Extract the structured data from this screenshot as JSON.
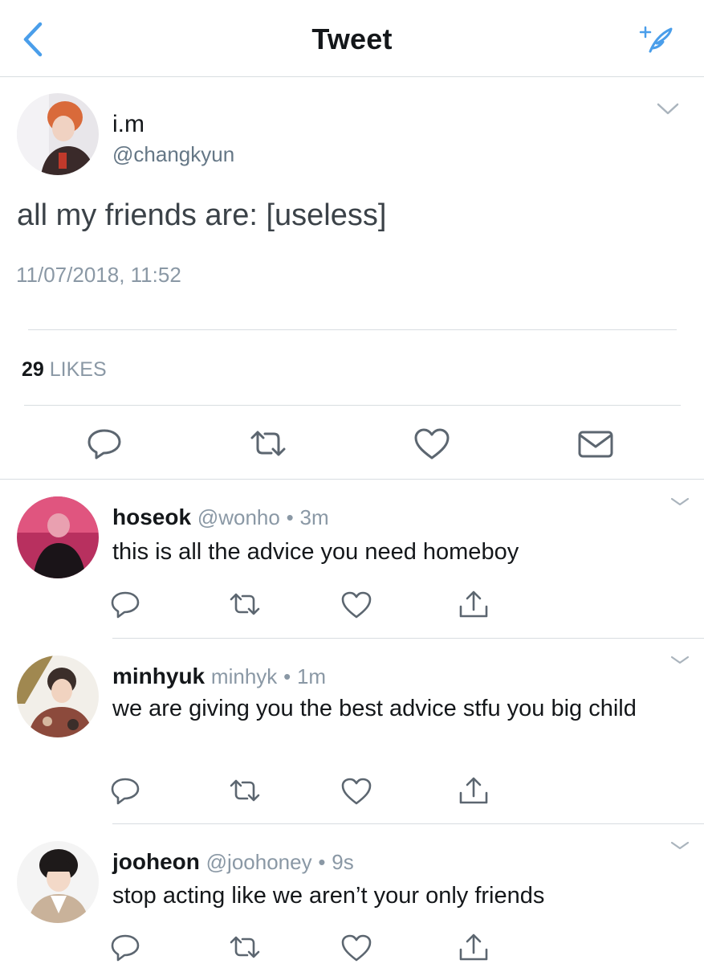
{
  "header": {
    "title": "Tweet",
    "back_icon": "chevron-left-icon",
    "compose_icon": "compose-sparkle-icon",
    "accent_color": "#4a9eea"
  },
  "tweet": {
    "name": "i.m",
    "handle": "@changkyun",
    "text": "all my friends are: [useless]",
    "timestamp": "11/07/2018, 11:52",
    "likes_count": "29",
    "likes_label": "LIKES",
    "actions": [
      "reply-icon",
      "retweet-icon",
      "like-icon",
      "message-icon"
    ]
  },
  "replies": [
    {
      "name": "hoseok",
      "handle": "@wonho",
      "separator": "•",
      "time": "3m",
      "text": "this is all the advice you need homeboy",
      "actions": [
        "reply-icon",
        "retweet-icon",
        "like-icon",
        "share-icon"
      ]
    },
    {
      "name": "minhyuk",
      "handle": "minhyk",
      "separator": "•",
      "time": "1m",
      "text": "we are giving you the best advice stfu you big child",
      "actions": [
        "reply-icon",
        "retweet-icon",
        "like-icon",
        "share-icon"
      ]
    },
    {
      "name": "jooheon",
      "handle": "@joohoney",
      "separator": "•",
      "time": "9s",
      "text": "stop acting like we aren’t your only friends",
      "actions": [
        "reply-icon",
        "retweet-icon",
        "like-icon",
        "share-icon"
      ]
    }
  ],
  "colors": {
    "text": "#14171a",
    "secondary": "#8a98a5",
    "divider": "#d8dde1",
    "icon": "#5c6670"
  }
}
